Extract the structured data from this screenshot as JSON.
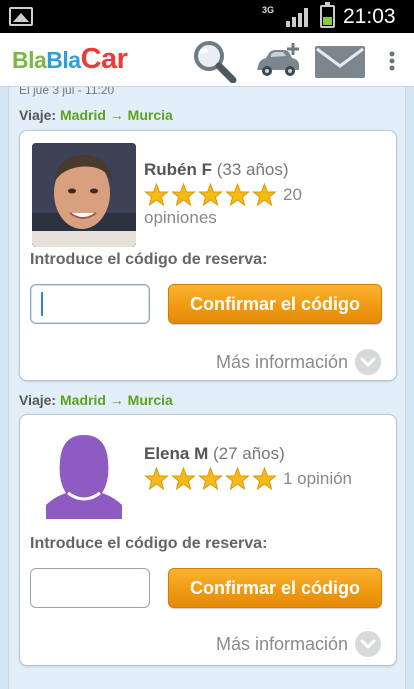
{
  "status_bar": {
    "network": "3G",
    "time": "21:03"
  },
  "app": {
    "logo": [
      "Bla",
      "Bla",
      "Car"
    ],
    "icons": [
      "search-icon",
      "add-car-icon",
      "mail-icon",
      "overflow-menu-icon"
    ]
  },
  "top_cutoff_text": "El jue 3 jul - 11:20",
  "bookings": [
    {
      "trip_prefix": "Viaje:",
      "from": "Madrid",
      "arrow": "→",
      "to": "Murcia",
      "driver_name": "Rubén F",
      "driver_age": "(33 años)",
      "rating_stars": 5,
      "reviews_count": "20",
      "reviews_label": "opiniones",
      "code_prompt": "Introduce el código de reserva:",
      "code_value": "",
      "confirm_label": "Confirmar el código",
      "more_label": "Más información"
    },
    {
      "trip_prefix": "Viaje:",
      "from": "Madrid",
      "arrow": "→",
      "to": "Murcia",
      "driver_name": "Elena M",
      "driver_age": "(27 años)",
      "rating_stars": 5,
      "reviews_text": "1 opinión",
      "code_prompt": "Introduce el código de reserva:",
      "code_value": "",
      "confirm_label": "Confirmar el código",
      "more_label": "Más información"
    }
  ],
  "colors": {
    "brand_green": "#7ab648",
    "brand_blue": "#2f9fd7",
    "brand_red": "#ef3b37",
    "button_orange": "#f09a12",
    "star_yellow": "#f5b91a",
    "route_green": "#5aa31c",
    "female_avatar_purple": "#8e5bc0"
  }
}
